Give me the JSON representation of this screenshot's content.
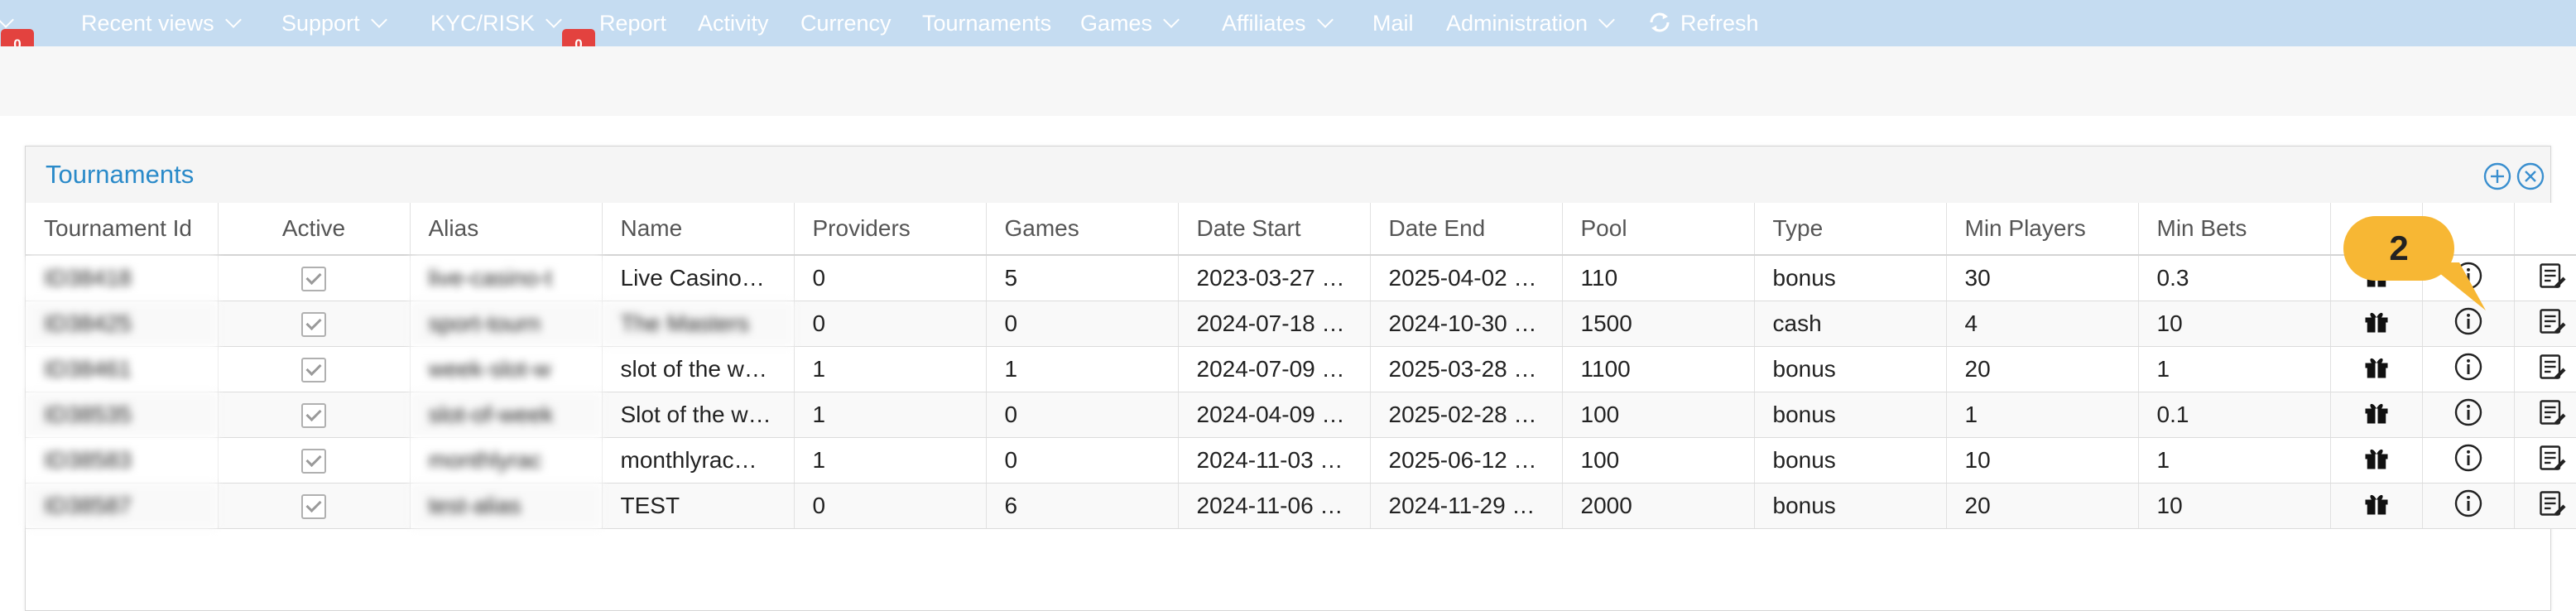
{
  "nav": {
    "items": [
      {
        "label": "Recent views",
        "dropdown": true
      },
      {
        "label": "Support",
        "dropdown": true
      },
      {
        "label": "KYC/RISK",
        "dropdown": true
      },
      {
        "label": "Report",
        "dropdown": false
      },
      {
        "label": "Activity",
        "dropdown": false
      },
      {
        "label": "Currency",
        "dropdown": false
      },
      {
        "label": "Tournaments",
        "dropdown": false
      },
      {
        "label": "Games",
        "dropdown": true
      },
      {
        "label": "Affiliates",
        "dropdown": true
      },
      {
        "label": "Mail",
        "dropdown": false
      },
      {
        "label": "Administration",
        "dropdown": true
      },
      {
        "label": "Refresh",
        "dropdown": false
      }
    ],
    "badges": [
      "0",
      "0"
    ],
    "colors": {
      "bar": "#c5dcf1",
      "badge": "#e3423f"
    }
  },
  "panel": {
    "title": "Tournaments",
    "annotation": "2",
    "header_icons": [
      "plus-circle-icon",
      "close-circle-icon"
    ],
    "title_color": "#2a8ac9"
  },
  "table": {
    "columns": [
      "Tournament Id",
      "Active",
      "Alias",
      "Name",
      "Providers",
      "Games",
      "Date Start",
      "Date End",
      "Pool",
      "Type",
      "Min Players",
      "Min Bets",
      "",
      "",
      ""
    ],
    "rows": [
      {
        "id": "ID38418",
        "active": true,
        "alias": "live-casino-t",
        "name": "Live Casino…",
        "providers": "0",
        "games": "5",
        "date_start": "2023-03-27 …",
        "date_end": "2025-04-02 …",
        "pool": "110",
        "type": "bonus",
        "min_players": "30",
        "min_bets": "0.3"
      },
      {
        "id": "ID38425",
        "active": true,
        "alias": "sport-tourn",
        "name": "The Masters",
        "providers": "0",
        "games": "0",
        "date_start": "2024-07-18 …",
        "date_end": "2024-10-30 …",
        "pool": "1500",
        "type": "cash",
        "min_players": "4",
        "min_bets": "10"
      },
      {
        "id": "ID38461",
        "active": true,
        "alias": "week-slot-w",
        "name": "slot of the w…",
        "providers": "1",
        "games": "1",
        "date_start": "2024-07-09 …",
        "date_end": "2025-03-28 …",
        "pool": "1100",
        "type": "bonus",
        "min_players": "20",
        "min_bets": "1"
      },
      {
        "id": "ID38535",
        "active": true,
        "alias": "slot-of-week",
        "name": "Slot of the w…",
        "providers": "1",
        "games": "0",
        "date_start": "2024-04-09 …",
        "date_end": "2025-02-28 …",
        "pool": "100",
        "type": "bonus",
        "min_players": "1",
        "min_bets": "0.1"
      },
      {
        "id": "ID38583",
        "active": true,
        "alias": "monthlyrac",
        "name": "monthlyrac…",
        "providers": "1",
        "games": "0",
        "date_start": "2024-11-03 …",
        "date_end": "2025-06-12 …",
        "pool": "100",
        "type": "bonus",
        "min_players": "10",
        "min_bets": "1"
      },
      {
        "id": "ID38587",
        "active": true,
        "alias": "test-alias",
        "name": "TEST",
        "providers": "0",
        "games": "6",
        "date_start": "2024-11-06 …",
        "date_end": "2024-11-29 …",
        "pool": "2000",
        "type": "bonus",
        "min_players": "20",
        "min_bets": "10"
      }
    ],
    "row_icons": [
      "gift-icon",
      "info-icon",
      "edit-list-icon"
    ]
  }
}
